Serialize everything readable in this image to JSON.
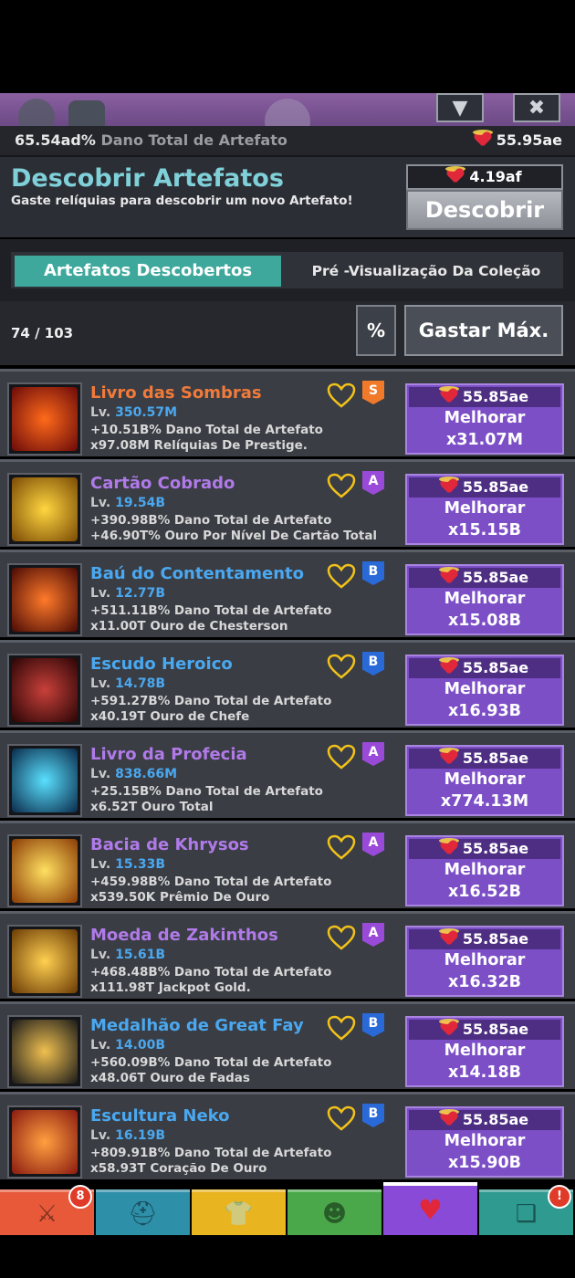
{
  "header": {
    "total_damage_value": "65.54ad%",
    "total_damage_label": "Dano Total de Artefato",
    "relics": "55.95ae"
  },
  "discover": {
    "title": "Descobrir Artefatos",
    "subtitle": "Gaste relíquias para descobrir um novo Artefato!",
    "cost": "4.19af",
    "button_label": "Descobrir"
  },
  "tabs": {
    "active": "Artefatos Descobertos",
    "inactive": "Pré -Visualização Da Coleção"
  },
  "controls": {
    "count": "74 / 103",
    "percent_label": "%",
    "spend_max_label": "Gastar Máx."
  },
  "artifacts": [
    {
      "name": "Livro das Sombras",
      "name_color": "#f07a3a",
      "level_prefix": "Lv.",
      "level": "350.57M",
      "effect1": "+10.51B% Dano Total de Artefato",
      "effect2": "x97.08M Relíquias De Prestige.",
      "tier": "S",
      "tier_color": "#f07a2a",
      "cost": "55.85ae",
      "button": "Melhorar",
      "mult": "x31.07M",
      "icon": "dark-book-icon"
    },
    {
      "name": "Cartão Cobrado",
      "name_color": "#b07ae8",
      "level_prefix": "Lv.",
      "level": "19.54B",
      "effect1": "+390.98B% Dano Total de Artefato",
      "effect2": "+46.90T% Ouro Por Nível De Cartão Total",
      "tier": "A",
      "tier_color": "#9a4ad8",
      "cost": "55.85ae",
      "button": "Melhorar",
      "mult": "x15.15B",
      "icon": "gold-card-icon"
    },
    {
      "name": "Baú do Contentamento",
      "name_color": "#4aa8f0",
      "level_prefix": "Lv.",
      "level": "12.77B",
      "effect1": "+511.11B% Dano Total de Artefato",
      "effect2": "x11.00T Ouro de Chesterson",
      "tier": "B",
      "tier_color": "#2a6ad8",
      "cost": "55.85ae",
      "button": "Melhorar",
      "mult": "x15.08B",
      "icon": "chest-icon"
    },
    {
      "name": "Escudo Heroico",
      "name_color": "#4aa8f0",
      "level_prefix": "Lv.",
      "level": "14.78B",
      "effect1": "+591.27B% Dano Total de Artefato",
      "effect2": "x40.19T Ouro de Chefe",
      "tier": "B",
      "tier_color": "#2a6ad8",
      "cost": "55.85ae",
      "button": "Melhorar",
      "mult": "x16.93B",
      "icon": "shield-icon"
    },
    {
      "name": "Livro da Profecia",
      "name_color": "#b07ae8",
      "level_prefix": "Lv.",
      "level": "838.66M",
      "effect1": "+25.15B% Dano Total de Artefato",
      "effect2": "x6.52T Ouro Total",
      "tier": "A",
      "tier_color": "#9a4ad8",
      "cost": "55.85ae",
      "button": "Melhorar",
      "mult": "x774.13M",
      "icon": "prophecy-book-icon"
    },
    {
      "name": "Bacia de Khrysos",
      "name_color": "#b07ae8",
      "level_prefix": "Lv.",
      "level": "15.33B",
      "effect1": "+459.98B% Dano Total de Artefato",
      "effect2": "x539.50K Prêmio De Ouro",
      "tier": "A",
      "tier_color": "#9a4ad8",
      "cost": "55.85ae",
      "button": "Melhorar",
      "mult": "x16.52B",
      "icon": "gold-basin-icon"
    },
    {
      "name": "Moeda de Zakinthos",
      "name_color": "#b07ae8",
      "level_prefix": "Lv.",
      "level": "15.61B",
      "effect1": "+468.48B% Dano Total de Artefato",
      "effect2": "x111.98T Jackpot Gold.",
      "tier": "A",
      "tier_color": "#9a4ad8",
      "cost": "55.85ae",
      "button": "Melhorar",
      "mult": "x16.32B",
      "icon": "coin-icon"
    },
    {
      "name": "Medalhão de Great Fay",
      "name_color": "#4aa8f0",
      "level_prefix": "Lv.",
      "level": "14.00B",
      "effect1": "+560.09B% Dano Total de Artefato",
      "effect2": "x48.06T Ouro de Fadas",
      "tier": "B",
      "tier_color": "#2a6ad8",
      "cost": "55.85ae",
      "button": "Melhorar",
      "mult": "x14.18B",
      "icon": "medallion-icon"
    },
    {
      "name": "Escultura Neko",
      "name_color": "#4aa8f0",
      "level_prefix": "Lv.",
      "level": "16.19B",
      "effect1": "+809.91B% Dano Total de Artefato",
      "effect2": "x58.93T Coração De Ouro",
      "tier": "B",
      "tier_color": "#2a6ad8",
      "cost": "55.85ae",
      "button": "Melhorar",
      "mult": "x15.90B",
      "icon": "neko-statue-icon"
    }
  ],
  "nav": [
    {
      "icon": "sword-icon",
      "color": "#e8593a",
      "badge": "8"
    },
    {
      "icon": "helmet-icon",
      "color": "#2e8fa8",
      "badge": ""
    },
    {
      "icon": "shirt-icon",
      "color": "#e8b420",
      "badge": ""
    },
    {
      "icon": "pet-icon",
      "color": "#4aa84a",
      "badge": ""
    },
    {
      "icon": "relic-heart-icon",
      "color": "#8a4ad8",
      "badge": ""
    },
    {
      "icon": "scroll-icon",
      "color": "#2e9a90",
      "badge": "!"
    }
  ]
}
